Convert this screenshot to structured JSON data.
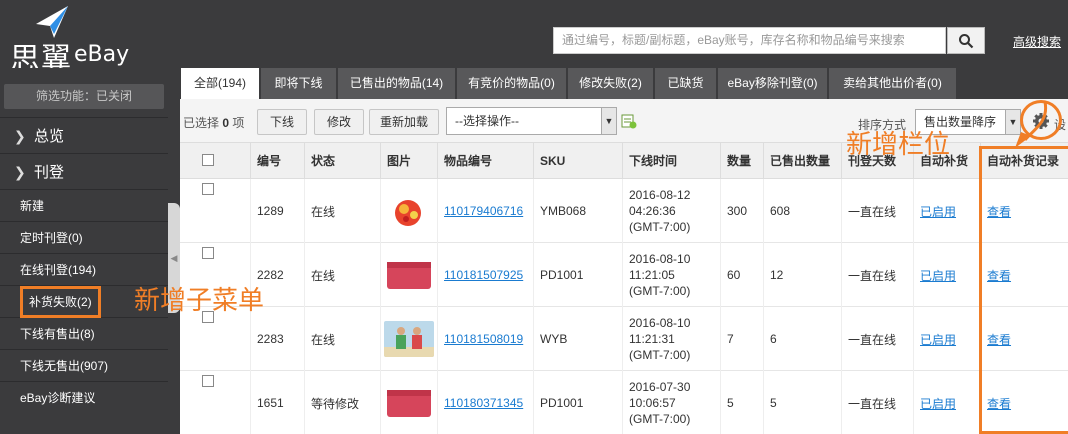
{
  "header": {
    "logo_cn": "思翼",
    "logo_en": "eBay",
    "search_placeholder": "通过编号，标题/副标题，eBay账号，库存名称和物品编号来搜索",
    "advanced_search": "高级搜索"
  },
  "sidebar": {
    "filter": "筛选功能：已关闭",
    "groups": [
      {
        "label": "总览"
      },
      {
        "label": "刊登"
      }
    ],
    "items": [
      {
        "label": "新建"
      },
      {
        "label": "定时刊登(0)"
      },
      {
        "label": "在线刊登(194)"
      },
      {
        "label": "补货失败(2)"
      },
      {
        "label": "下线有售出(8)"
      },
      {
        "label": "下线无售出(907)"
      },
      {
        "label": "eBay诊断建议"
      }
    ]
  },
  "tabs": [
    {
      "label": "全部(194)"
    },
    {
      "label": "即将下线"
    },
    {
      "label": "已售出的物品(14)"
    },
    {
      "label": "有竞价的物品(0)"
    },
    {
      "label": "修改失败(2)"
    },
    {
      "label": "已缺货"
    },
    {
      "label": "eBay移除刊登(0)"
    },
    {
      "label": "卖给其他出价者(0)"
    }
  ],
  "toolbar": {
    "selected_prefix": "已选择",
    "selected_count": "0",
    "selected_suffix": "项",
    "btn_offline": "下线",
    "btn_edit": "修改",
    "btn_reload": "重新加载",
    "action_select": "--选择操作--",
    "sort_label": "排序方式",
    "sort_value": "售出数量降序",
    "settings_text": "设"
  },
  "columns": [
    "编号",
    "状态",
    "图片",
    "物品编号",
    "SKU",
    "下线时间",
    "数量",
    "已售出数量",
    "刊登天数",
    "自动补货",
    "自动补货记录"
  ],
  "rows": [
    {
      "id": "1289",
      "status": "在线",
      "item_no": "110179406716",
      "sku": "YMB068",
      "time": [
        "2016-08-12",
        "04:26:36",
        "(GMT-7:00)"
      ],
      "qty": "300",
      "sold": "608",
      "days": "一直在线",
      "auto": "已启用",
      "record": "查看",
      "thumb": "fruit"
    },
    {
      "id": "2282",
      "status": "在线",
      "item_no": "110181507925",
      "sku": "PD1001",
      "time": [
        "2016-08-10",
        "11:21:05",
        "(GMT-7:00)"
      ],
      "qty": "60",
      "sold": "12",
      "days": "一直在线",
      "auto": "已启用",
      "record": "查看",
      "thumb": "pink"
    },
    {
      "id": "2283",
      "status": "在线",
      "item_no": "110181508019",
      "sku": "WYB",
      "time": [
        "2016-08-10",
        "11:21:31",
        "(GMT-7:00)"
      ],
      "qty": "7",
      "sold": "6",
      "days": "一直在线",
      "auto": "已启用",
      "record": "查看",
      "thumb": "kids"
    },
    {
      "id": "1651",
      "status": "等待修改",
      "item_no": "110180371345",
      "sku": "PD1001",
      "time": [
        "2016-07-30",
        "10:06:57",
        "(GMT-7:00)"
      ],
      "qty": "5",
      "sold": "5",
      "days": "一直在线",
      "auto": "已启用",
      "record": "查看",
      "thumb": "pink"
    }
  ],
  "annotations": {
    "new_column": "新增栏位",
    "new_submenu": "新增子菜单"
  },
  "colors": {
    "accent": "#f07e26",
    "link": "#1a7bd0",
    "dark": "#3b3b3d"
  }
}
